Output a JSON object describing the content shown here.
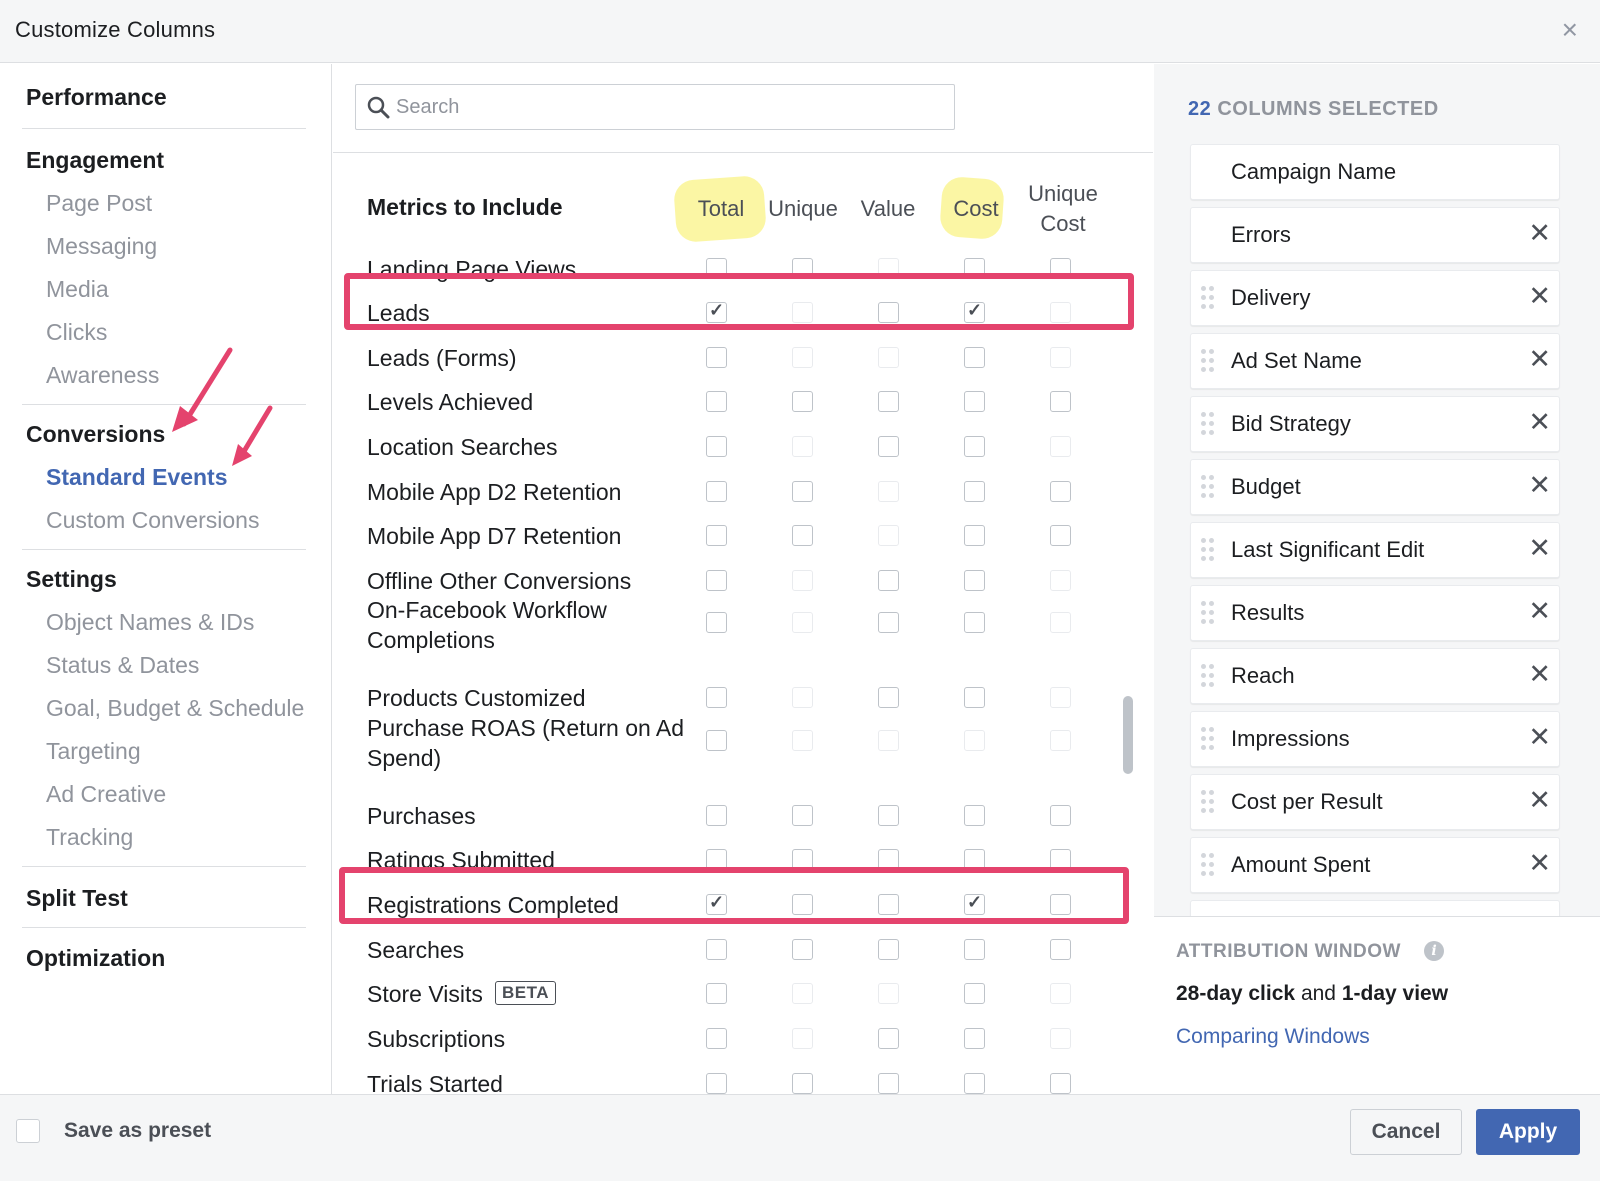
{
  "dialog": {
    "title": "Customize Columns",
    "close_symbol": "×"
  },
  "leftnav": {
    "sections": [
      {
        "heading": "Performance",
        "items": []
      },
      {
        "heading": "Engagement",
        "items": [
          "Page Post",
          "Messaging",
          "Media",
          "Clicks",
          "Awareness"
        ]
      },
      {
        "heading": "Conversions",
        "items": [
          "Standard Events",
          "Custom Conversions"
        ]
      },
      {
        "heading": "Settings",
        "items": [
          "Object Names & IDs",
          "Status & Dates",
          "Goal, Budget & Schedule",
          "Targeting",
          "Ad Creative",
          "Tracking"
        ]
      },
      {
        "heading": "Split Test",
        "items": []
      },
      {
        "heading": "Optimization",
        "items": []
      }
    ],
    "active_item": "Standard Events"
  },
  "search": {
    "placeholder": "Search",
    "value": ""
  },
  "metrics": {
    "title": "Metrics to Include",
    "columns": [
      "Total",
      "Unique",
      "Value",
      "Cost",
      "Unique\nCost"
    ],
    "highlighted_columns": [
      "Total",
      "Cost"
    ],
    "rows": [
      {
        "label": "Landing Page Views",
        "checked": [
          false,
          false,
          false,
          false,
          false
        ],
        "enabled": [
          true,
          true,
          false,
          true,
          true
        ]
      },
      {
        "label": "Leads",
        "checked": [
          true,
          false,
          false,
          true,
          false
        ],
        "enabled": [
          true,
          false,
          true,
          true,
          false
        ]
      },
      {
        "label": "Leads (Forms)",
        "checked": [
          false,
          false,
          false,
          false,
          false
        ],
        "enabled": [
          true,
          false,
          false,
          true,
          false
        ]
      },
      {
        "label": "Levels Achieved",
        "checked": [
          false,
          false,
          false,
          false,
          false
        ],
        "enabled": [
          true,
          true,
          true,
          true,
          true
        ]
      },
      {
        "label": "Location Searches",
        "checked": [
          false,
          false,
          false,
          false,
          false
        ],
        "enabled": [
          true,
          false,
          true,
          true,
          false
        ]
      },
      {
        "label": "Mobile App D2 Retention",
        "checked": [
          false,
          false,
          false,
          false,
          false
        ],
        "enabled": [
          true,
          true,
          false,
          true,
          true
        ]
      },
      {
        "label": "Mobile App D7 Retention",
        "checked": [
          false,
          false,
          false,
          false,
          false
        ],
        "enabled": [
          true,
          true,
          false,
          true,
          true
        ]
      },
      {
        "label": "Offline Other Conversions",
        "checked": [
          false,
          false,
          false,
          false,
          false
        ],
        "enabled": [
          true,
          false,
          true,
          true,
          false
        ]
      },
      {
        "label": "On-Facebook Workflow Completions",
        "checked": [
          false,
          false,
          false,
          false,
          false
        ],
        "enabled": [
          true,
          false,
          true,
          true,
          false
        ]
      },
      {
        "label": "Products Customized",
        "checked": [
          false,
          false,
          false,
          false,
          false
        ],
        "enabled": [
          true,
          false,
          true,
          true,
          false
        ]
      },
      {
        "label": "Purchase ROAS (Return on Ad Spend)",
        "checked": [
          false,
          false,
          false,
          false,
          false
        ],
        "enabled": [
          true,
          false,
          false,
          false,
          false
        ]
      },
      {
        "label": "Purchases",
        "checked": [
          false,
          false,
          false,
          false,
          false
        ],
        "enabled": [
          true,
          true,
          true,
          true,
          true
        ]
      },
      {
        "label": "Ratings Submitted",
        "checked": [
          false,
          false,
          false,
          false,
          false
        ],
        "enabled": [
          true,
          true,
          true,
          true,
          true
        ]
      },
      {
        "label": "Registrations Completed",
        "checked": [
          true,
          false,
          false,
          true,
          false
        ],
        "enabled": [
          true,
          true,
          true,
          true,
          true
        ]
      },
      {
        "label": "Searches",
        "checked": [
          false,
          false,
          false,
          false,
          false
        ],
        "enabled": [
          true,
          true,
          true,
          true,
          true
        ]
      },
      {
        "label": "Store Visits",
        "badge": "BETA",
        "checked": [
          false,
          false,
          false,
          false,
          false
        ],
        "enabled": [
          true,
          false,
          false,
          true,
          false
        ]
      },
      {
        "label": "Subscriptions",
        "checked": [
          false,
          false,
          false,
          false,
          false
        ],
        "enabled": [
          true,
          false,
          true,
          true,
          false
        ]
      },
      {
        "label": "Trials Started",
        "checked": [
          false,
          false,
          false,
          false,
          false
        ],
        "enabled": [
          true,
          true,
          true,
          true,
          true
        ]
      }
    ],
    "check_symbol": "✓"
  },
  "selected": {
    "count": "22",
    "count_label": "COLUMNS SELECTED",
    "items": [
      {
        "label": "Campaign Name",
        "removable": false,
        "draggable": false
      },
      {
        "label": "Errors",
        "removable": true,
        "draggable": false
      },
      {
        "label": "Delivery",
        "removable": true,
        "draggable": true
      },
      {
        "label": "Ad Set Name",
        "removable": true,
        "draggable": true
      },
      {
        "label": "Bid Strategy",
        "removable": true,
        "draggable": true
      },
      {
        "label": "Budget",
        "removable": true,
        "draggable": true
      },
      {
        "label": "Last Significant Edit",
        "removable": true,
        "draggable": true
      },
      {
        "label": "Results",
        "removable": true,
        "draggable": true
      },
      {
        "label": "Reach",
        "removable": true,
        "draggable": true
      },
      {
        "label": "Impressions",
        "removable": true,
        "draggable": true
      },
      {
        "label": "Cost per Result",
        "removable": true,
        "draggable": true
      },
      {
        "label": "Amount Spent",
        "removable": true,
        "draggable": true
      }
    ],
    "remove_symbol": "✕"
  },
  "attribution": {
    "title": "ATTRIBUTION WINDOW",
    "click": "28-day click",
    "and": "and",
    "view": "1-day view",
    "link": "Comparing Windows",
    "info_symbol": "i"
  },
  "footer": {
    "save_preset": "Save as preset",
    "cancel": "Cancel",
    "apply": "Apply"
  },
  "colors": {
    "accent": "#4267b2",
    "highlight_red": "#e4436d",
    "marker_yellow": "#fbf59a"
  }
}
